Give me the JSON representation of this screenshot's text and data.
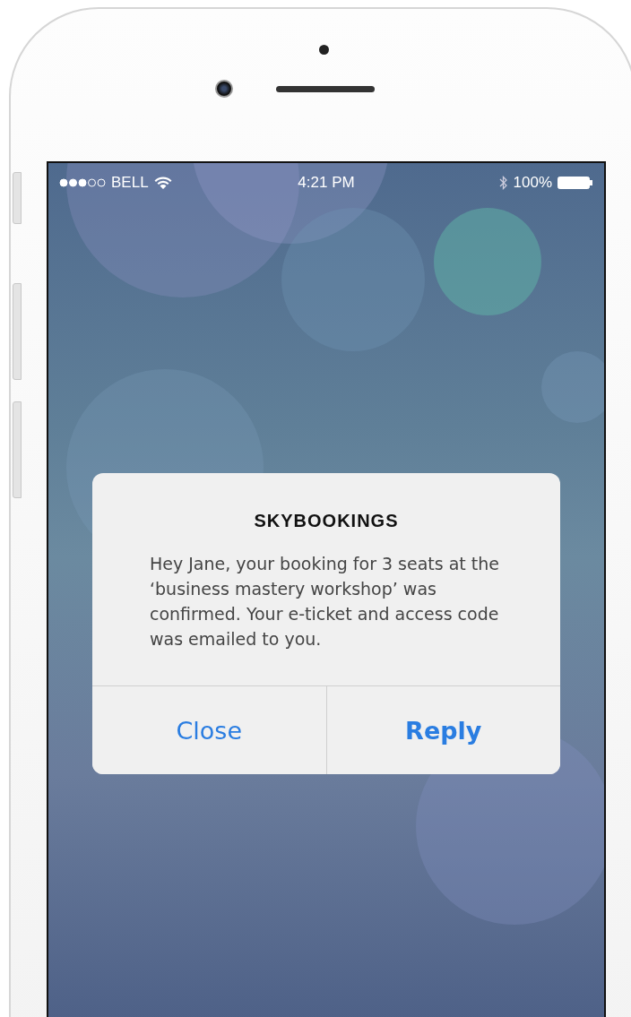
{
  "status_bar": {
    "carrier": "BELL",
    "time": "4:21 PM",
    "battery": "100%"
  },
  "alert": {
    "title": "SKYBOOKINGS",
    "message": "Hey Jane, your booking for 3 seats at the ‘business mastery workshop’ was confirmed.  Your e-ticket and access code was emailed to you.",
    "buttons": [
      {
        "label": "Close",
        "preferred": false
      },
      {
        "label": "Reply",
        "preferred": true
      }
    ]
  }
}
